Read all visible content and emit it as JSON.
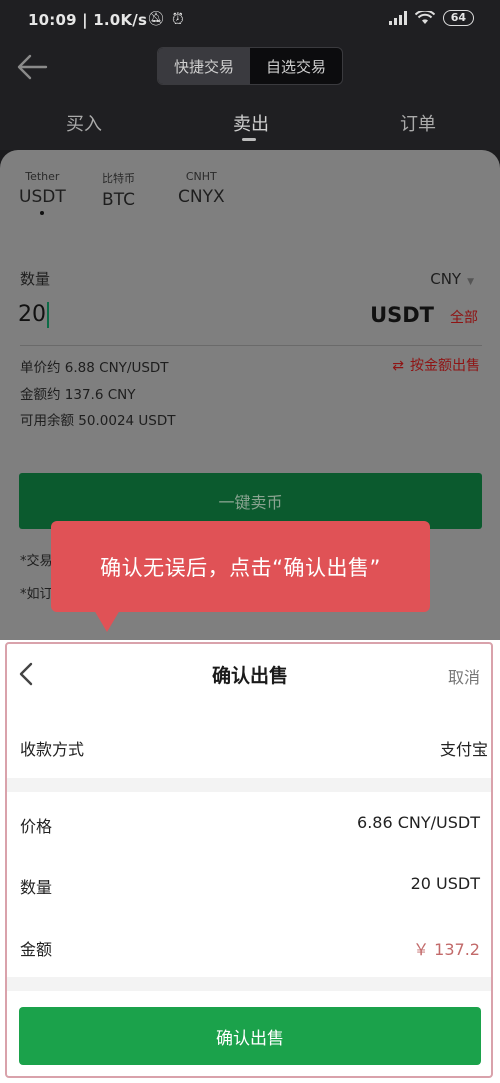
{
  "status_bar": {
    "time_speed": "10:09 | 1.0K/s",
    "battery": "64"
  },
  "header": {
    "mode_tabs": [
      "快捷交易",
      "自选交易"
    ],
    "active_mode": "快捷交易"
  },
  "trade_tabs": {
    "buy": "买入",
    "sell": "卖出",
    "orders": "订单",
    "active": "卖出"
  },
  "coins": [
    {
      "sub": "Tether",
      "code": "USDT"
    },
    {
      "sub": "比特币",
      "code": "BTC"
    },
    {
      "sub": "CNHT",
      "code": "CNYX"
    }
  ],
  "form": {
    "quantity_label": "数量",
    "currency": "CNY",
    "quantity_value": "20",
    "unit": "USDT",
    "all_label": "全部",
    "unit_price": "单价约 6.88 CNY/USDT",
    "amount": "金额约 137.6 CNY",
    "balance": "可用余额 50.0024 USDT",
    "sell_by_amount": "按金额出售",
    "sell_button": "一键卖币",
    "note1": "*交易",
    "note2": "*如订"
  },
  "tooltip": {
    "text": "确认无误后，点击“确认出售”"
  },
  "confirm_sheet": {
    "title": "确认出售",
    "cancel": "取消",
    "payment_label": "收款方式",
    "payment_value": "支付宝",
    "price_label": "价格",
    "price_value": "6.86 CNY/USDT",
    "quantity_label": "数量",
    "quantity_value": "20 USDT",
    "total_label": "金额",
    "total_value": "￥ 137.2",
    "confirm_button": "确认出售"
  },
  "colors": {
    "primary_green": "#1ba24b",
    "tooltip_red": "#e05256",
    "highlight_border": "#d9a2ab"
  }
}
